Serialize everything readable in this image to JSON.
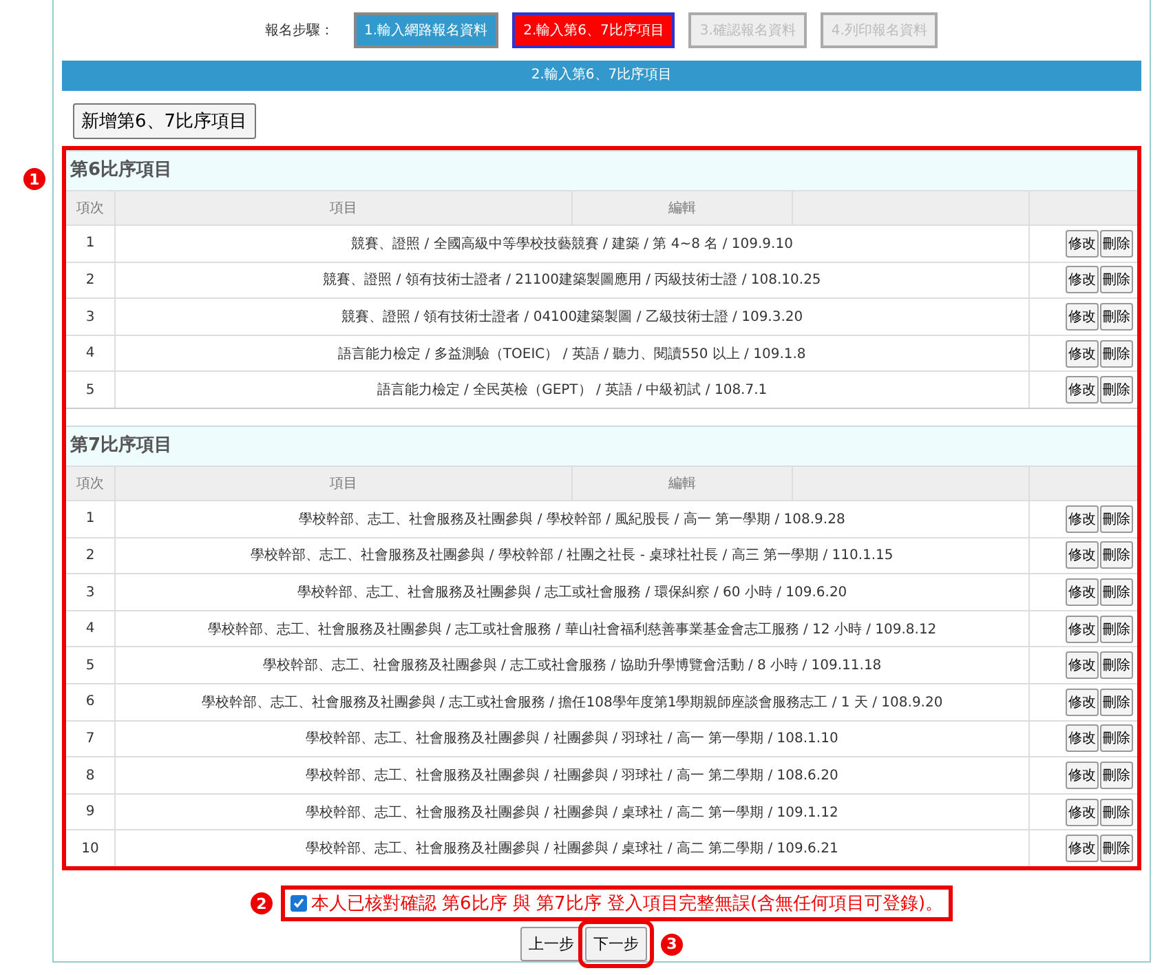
{
  "steps": {
    "label": "報名步驟：",
    "items": [
      {
        "label": "1.輸入網路報名資料",
        "kind": "done"
      },
      {
        "label": "2.輸入第6、7比序項目",
        "kind": "current"
      },
      {
        "label": "3.確認報名資料",
        "kind": "disabled"
      },
      {
        "label": "4.列印報名資料",
        "kind": "disabled"
      }
    ]
  },
  "banner": "2.輸入第6、7比序項目",
  "add_button": "新增第6、7比序項目",
  "markers": [
    "1",
    "2",
    "3"
  ],
  "sections": [
    {
      "title": "第6比序項目",
      "columns": [
        "項次",
        "項目",
        "編輯"
      ],
      "rows": [
        {
          "no": "1",
          "item": "競賽、證照 / 全國高級中等學校技藝競賽 / 建築 / 第 4~8 名 / 109.9.10",
          "actions": [
            "修改",
            "刪除"
          ]
        },
        {
          "no": "2",
          "item": "競賽、證照 / 領有技術士證者 / 21100建築製圖應用 / 丙級技術士證 / 108.10.25",
          "actions": [
            "修改",
            "刪除"
          ]
        },
        {
          "no": "3",
          "item": "競賽、證照 / 領有技術士證者 / 04100建築製圖 / 乙級技術士證 / 109.3.20",
          "actions": [
            "修改",
            "刪除"
          ]
        },
        {
          "no": "4",
          "item": "語言能力檢定 / 多益測驗（TOEIC） / 英語 / 聽力、閱讀550 以上 / 109.1.8",
          "actions": [
            "修改",
            "刪除"
          ]
        },
        {
          "no": "5",
          "item": "語言能力檢定 / 全民英檢（GEPT） / 英語 / 中級初試 / 108.7.1",
          "actions": [
            "修改",
            "刪除"
          ]
        }
      ]
    },
    {
      "title": "第7比序項目",
      "columns": [
        "項次",
        "項目",
        "編輯"
      ],
      "rows": [
        {
          "no": "1",
          "item": "學校幹部、志工、社會服務及社團參與 / 學校幹部 / 風紀股長 / 高一 第一學期 / 108.9.28",
          "actions": [
            "修改",
            "刪除"
          ]
        },
        {
          "no": "2",
          "item": "學校幹部、志工、社會服務及社團參與 / 學校幹部 / 社團之社長 - 桌球社社長 / 高三 第一學期 / 110.1.15",
          "actions": [
            "修改",
            "刪除"
          ]
        },
        {
          "no": "3",
          "item": "學校幹部、志工、社會服務及社團參與 / 志工或社會服務 / 環保糾察 / 60 小時 / 109.6.20",
          "actions": [
            "修改",
            "刪除"
          ]
        },
        {
          "no": "4",
          "item": "學校幹部、志工、社會服務及社團參與 / 志工或社會服務 / 華山社會福利慈善事業基金會志工服務 / 12 小時 / 109.8.12",
          "actions": [
            "修改",
            "刪除"
          ]
        },
        {
          "no": "5",
          "item": "學校幹部、志工、社會服務及社團參與 / 志工或社會服務 / 協助升學博覽會活動 / 8 小時 / 109.11.18",
          "actions": [
            "修改",
            "刪除"
          ]
        },
        {
          "no": "6",
          "item": "學校幹部、志工、社會服務及社團參與 / 志工或社會服務 / 擔任108學年度第1學期親師座談會服務志工 / 1 天 / 108.9.20",
          "actions": [
            "修改",
            "刪除"
          ]
        },
        {
          "no": "7",
          "item": "學校幹部、志工、社會服務及社團參與 / 社團參與 / 羽球社 / 高一 第一學期 / 108.1.10",
          "actions": [
            "修改",
            "刪除"
          ]
        },
        {
          "no": "8",
          "item": "學校幹部、志工、社會服務及社團參與 / 社團參與 / 羽球社 / 高一 第二學期 / 108.6.20",
          "actions": [
            "修改",
            "刪除"
          ]
        },
        {
          "no": "9",
          "item": "學校幹部、志工、社會服務及社團參與 / 社團參與 / 桌球社 / 高二 第一學期 / 109.1.12",
          "actions": [
            "修改",
            "刪除"
          ]
        },
        {
          "no": "10",
          "item": "學校幹部、志工、社會服務及社團參與 / 社團參與 / 桌球社 / 高二 第二學期 / 109.6.21",
          "actions": [
            "修改",
            "刪除"
          ]
        }
      ]
    }
  ],
  "confirm": {
    "label": "本人已核對確認 第6比序 與 第7比序 登入項目完整無誤(含無任何項目可登錄)。",
    "checked": true
  },
  "nav": [
    "上一步",
    "下一步"
  ]
}
